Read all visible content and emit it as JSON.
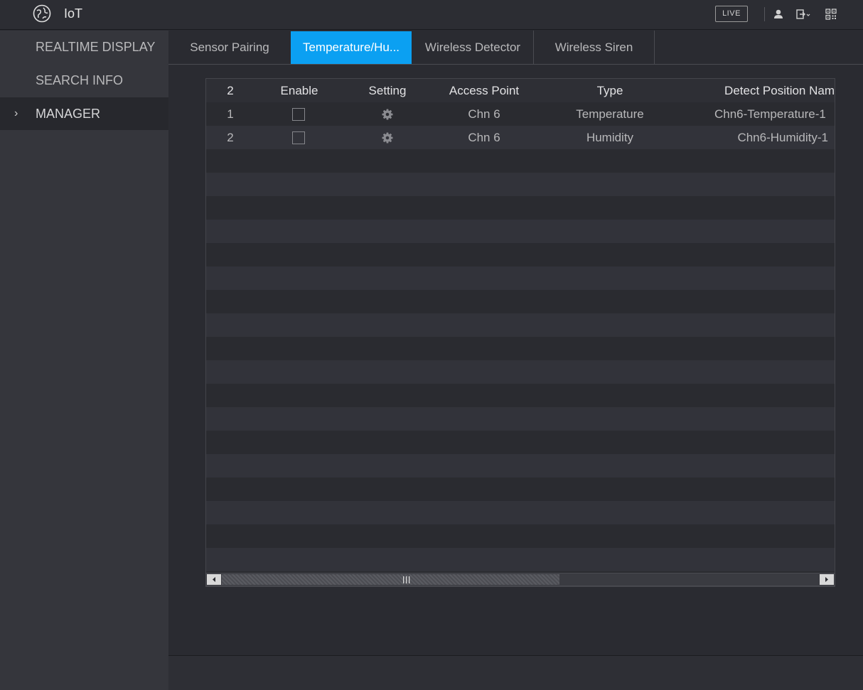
{
  "app": {
    "title": "IoT",
    "live_label": "LIVE"
  },
  "icons": {
    "app": "globe-icon",
    "user": "user-icon",
    "logout": "logout-icon",
    "qr": "qr-code-icon"
  },
  "colors": {
    "accent": "#0ba0f2"
  },
  "sidebar": {
    "items": [
      {
        "label": "REALTIME DISPLAY"
      },
      {
        "label": "SEARCH INFO"
      },
      {
        "label": "MANAGER",
        "arrow": "›"
      }
    ]
  },
  "tabs": [
    {
      "label": "Sensor Pairing"
    },
    {
      "label": "Temperature/Hu..."
    },
    {
      "label": "Wireless Detector"
    },
    {
      "label": "Wireless Siren"
    }
  ],
  "table": {
    "headers": {
      "count": "2",
      "enable": "Enable",
      "setting": "Setting",
      "access_point": "Access Point",
      "type": "Type",
      "detect_position": "Detect Position Nam"
    },
    "rows": [
      {
        "index": "1",
        "access_point": "Chn 6",
        "type": "Temperature",
        "detect_position": "Chn6-Temperature-1"
      },
      {
        "index": "2",
        "access_point": "Chn 6",
        "type": "Humidity",
        "detect_position": "Chn6-Humidity-1"
      }
    ]
  }
}
